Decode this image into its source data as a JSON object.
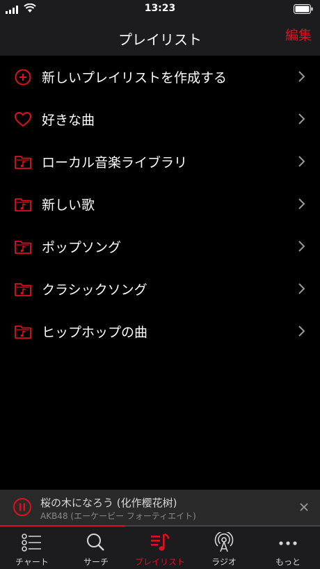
{
  "status": {
    "time": "13:23"
  },
  "nav": {
    "title": "プレイリスト",
    "edit_label": "編集"
  },
  "list": [
    {
      "label": "新しいプレイリストを作成する",
      "icon": "add-circle-icon"
    },
    {
      "label": "好きな曲",
      "icon": "heart-icon"
    },
    {
      "label": "ローカル音楽ライブラリ",
      "icon": "music-folder-icon"
    },
    {
      "label": "新しい歌",
      "icon": "music-folder-icon"
    },
    {
      "label": "ポップソング",
      "icon": "music-folder-icon"
    },
    {
      "label": "クラシックソング",
      "icon": "music-folder-icon"
    },
    {
      "label": "ヒップホップの曲",
      "icon": "music-folder-icon"
    }
  ],
  "player": {
    "title": "桜の木になろう (化作樱花树)",
    "artist": "AKB48 (エーケービー フォーティエイト)",
    "progress": 0.39
  },
  "tabs": [
    {
      "label": "チャート",
      "icon": "chart-list-icon",
      "active": false
    },
    {
      "label": "サーチ",
      "icon": "search-icon",
      "active": false
    },
    {
      "label": "プレイリスト",
      "icon": "playlist-icon",
      "active": true
    },
    {
      "label": "ラジオ",
      "icon": "radio-icon",
      "active": false
    },
    {
      "label": "もっと",
      "icon": "more-icon",
      "active": false
    }
  ],
  "colors": {
    "accent": "#e0101f",
    "background": "#000000",
    "bar": "#1c1c1e"
  }
}
